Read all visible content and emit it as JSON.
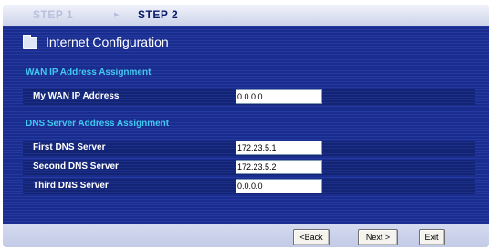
{
  "steps": {
    "step1": "STEP 1",
    "step2": "STEP 2",
    "arrow": "▸"
  },
  "page": {
    "title": "Internet Configuration",
    "icon": "folder-icon"
  },
  "wan_section": {
    "title": "WAN IP Address Assignment",
    "fields": [
      {
        "label": "My WAN IP Address",
        "value": "0.0.0.0"
      }
    ]
  },
  "dns_section": {
    "title": "DNS Server Address Assignment",
    "fields": [
      {
        "label": "First DNS Server",
        "value": "172.23.5.1"
      },
      {
        "label": "Second DNS Server",
        "value": "172.23.5.2"
      },
      {
        "label": "Third DNS Server",
        "value": "0.0.0.0"
      }
    ]
  },
  "buttons": {
    "back": "<Back",
    "next": "Next >",
    "exit": "Exit"
  },
  "colors": {
    "panel_blue": "#1a2c8e",
    "section_title": "#40c8f0",
    "active_step": "#0a1a6a"
  }
}
